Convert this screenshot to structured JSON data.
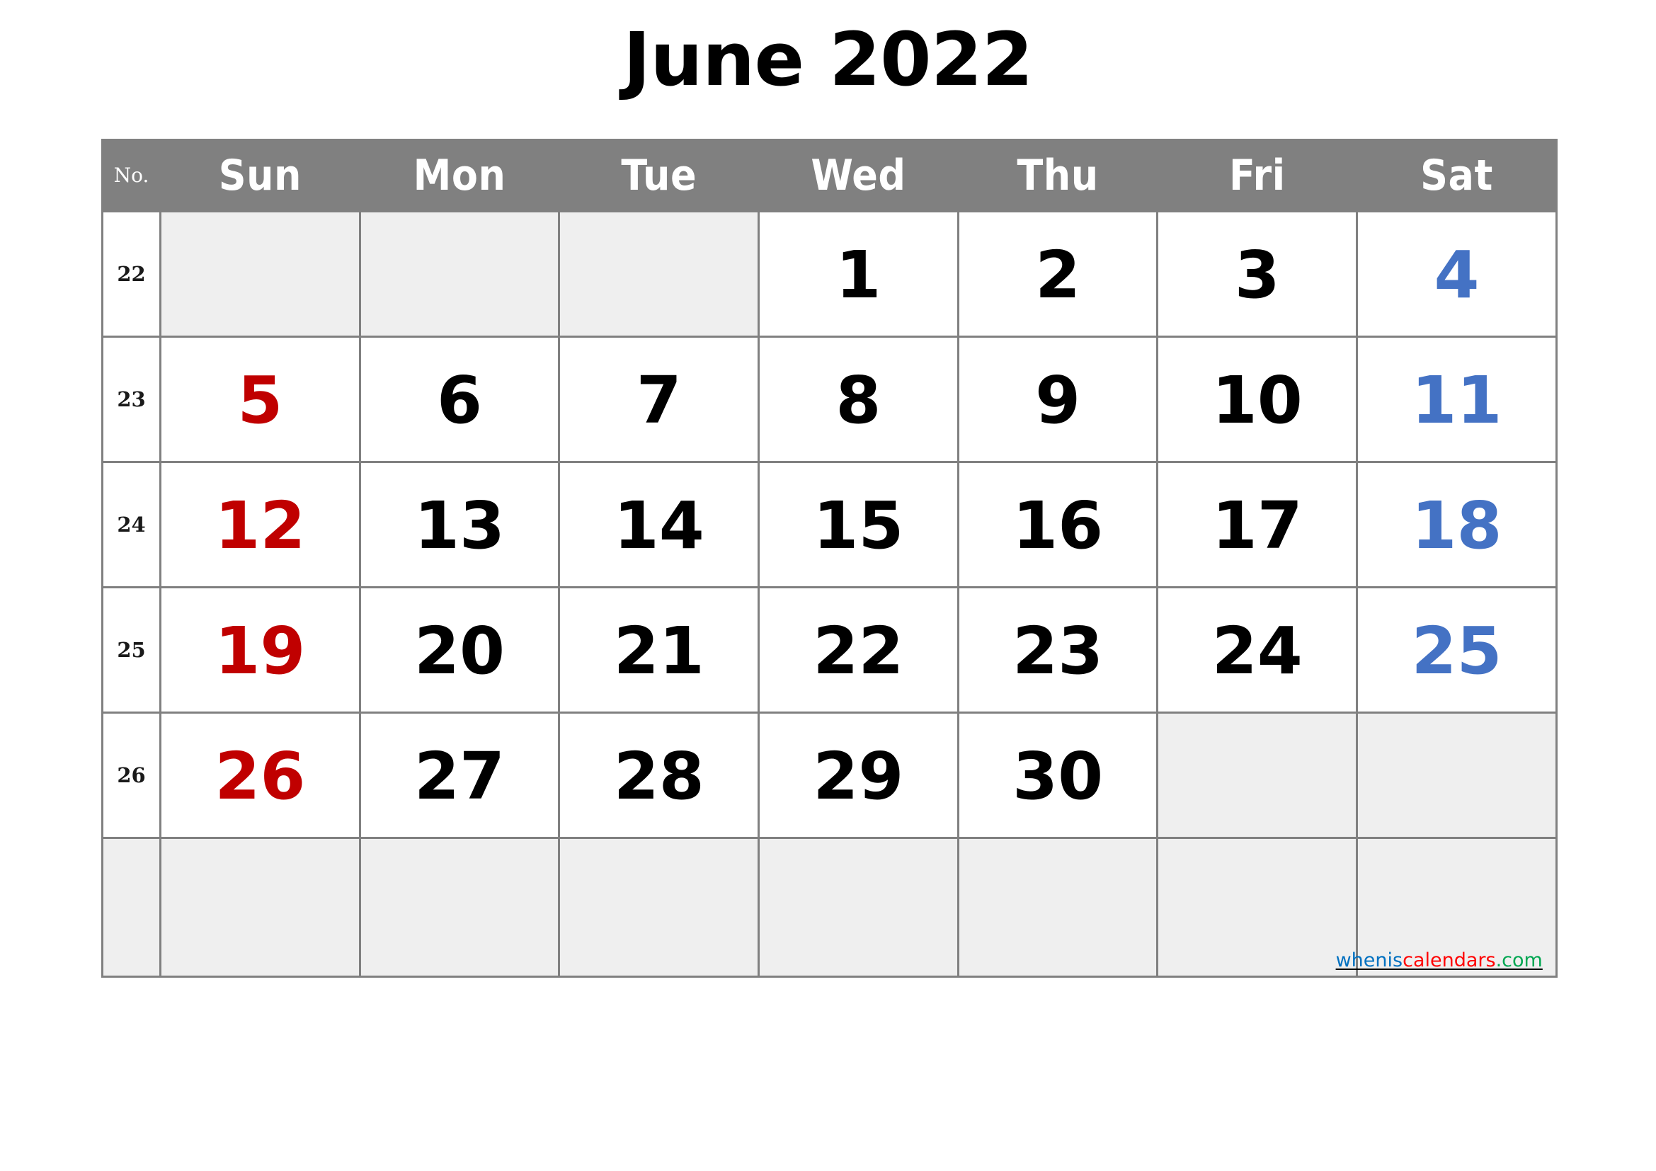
{
  "title": "June 2022",
  "header": {
    "week_no_label": "No.",
    "days": [
      "Sun",
      "Mon",
      "Tue",
      "Wed",
      "Thu",
      "Fri",
      "Sat"
    ]
  },
  "colors": {
    "header_background": "#808080",
    "header_text": "#ffffff",
    "blank_cell": "#efefef",
    "sunday": "#c00000",
    "saturday": "#4472c4",
    "weekday": "#000000",
    "grid_line": "#808080"
  },
  "weeks": [
    {
      "no": "22",
      "days": [
        {
          "label": "",
          "kind": "blank"
        },
        {
          "label": "",
          "kind": "blank"
        },
        {
          "label": "",
          "kind": "blank"
        },
        {
          "label": "1",
          "kind": "weekday"
        },
        {
          "label": "2",
          "kind": "weekday"
        },
        {
          "label": "3",
          "kind": "weekday"
        },
        {
          "label": "4",
          "kind": "sat"
        }
      ]
    },
    {
      "no": "23",
      "days": [
        {
          "label": "5",
          "kind": "sun"
        },
        {
          "label": "6",
          "kind": "weekday"
        },
        {
          "label": "7",
          "kind": "weekday"
        },
        {
          "label": "8",
          "kind": "weekday"
        },
        {
          "label": "9",
          "kind": "weekday"
        },
        {
          "label": "10",
          "kind": "weekday"
        },
        {
          "label": "11",
          "kind": "sat"
        }
      ]
    },
    {
      "no": "24",
      "days": [
        {
          "label": "12",
          "kind": "sun"
        },
        {
          "label": "13",
          "kind": "weekday"
        },
        {
          "label": "14",
          "kind": "weekday"
        },
        {
          "label": "15",
          "kind": "weekday"
        },
        {
          "label": "16",
          "kind": "weekday"
        },
        {
          "label": "17",
          "kind": "weekday"
        },
        {
          "label": "18",
          "kind": "sat"
        }
      ]
    },
    {
      "no": "25",
      "days": [
        {
          "label": "19",
          "kind": "sun"
        },
        {
          "label": "20",
          "kind": "weekday"
        },
        {
          "label": "21",
          "kind": "weekday"
        },
        {
          "label": "22",
          "kind": "weekday"
        },
        {
          "label": "23",
          "kind": "weekday"
        },
        {
          "label": "24",
          "kind": "weekday"
        },
        {
          "label": "25",
          "kind": "sat"
        }
      ]
    },
    {
      "no": "26",
      "days": [
        {
          "label": "26",
          "kind": "sun"
        },
        {
          "label": "27",
          "kind": "weekday"
        },
        {
          "label": "28",
          "kind": "weekday"
        },
        {
          "label": "29",
          "kind": "weekday"
        },
        {
          "label": "30",
          "kind": "weekday"
        },
        {
          "label": "",
          "kind": "blank"
        },
        {
          "label": "",
          "kind": "blank"
        }
      ]
    }
  ],
  "trailing_row": {
    "no": "",
    "days": [
      "",
      "",
      "",
      "",
      "",
      "",
      ""
    ]
  },
  "watermark": {
    "part1": "whenis",
    "part2": "calendars",
    "part3": ".com"
  }
}
